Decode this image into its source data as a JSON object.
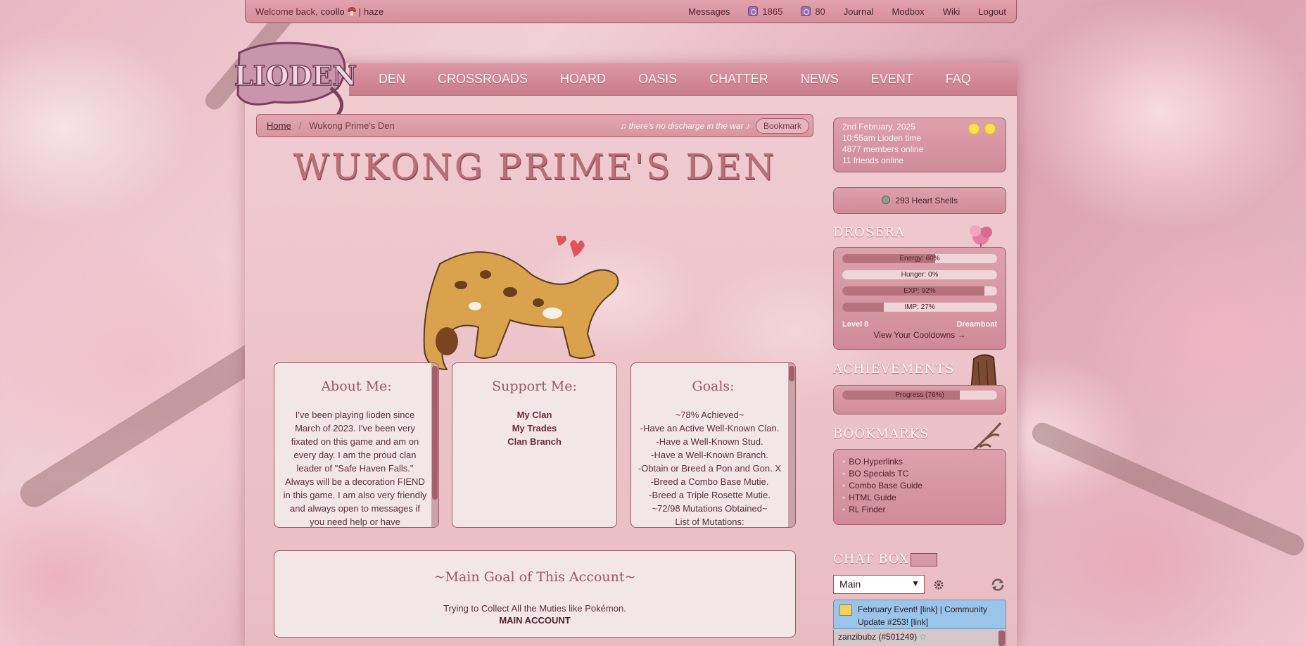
{
  "topbar": {
    "welcome": "Welcome back,",
    "username": "coollo",
    "separator": "|",
    "secondary_user": "haze",
    "messages": "Messages",
    "currency1": "1865",
    "currency2": "80",
    "journal": "Journal",
    "modbox": "Modbox",
    "wiki": "Wiki",
    "logout": "Logout"
  },
  "nav": [
    "DEN",
    "CROSSROADS",
    "HOARD",
    "OASIS",
    "CHATTER",
    "NEWS",
    "EVENT",
    "FAQ"
  ],
  "logo_text": "LIODEN",
  "breadcrumb": {
    "home": "Home",
    "sep": "/",
    "current": "Wukong Prime's Den",
    "song": "♫ there's no discharge in the war ♪",
    "bookmark": "Bookmark"
  },
  "den_title": "WUKONG PRIME'S DEN",
  "about": {
    "title": "About Me:",
    "body": "I've been playing lioden since March of 2023. I've been very fixated on this game and am on every day. I am the proud clan leader of \"Safe Haven Falls.\" Always will be a decoration FIEND in this game. I am also very friendly and always open to messages if you need help or have"
  },
  "support": {
    "title": "Support Me:",
    "links": [
      "My Clan",
      "My Trades",
      "Clan Branch"
    ]
  },
  "goals": {
    "title": "Goals:",
    "lines": [
      "~78% Achieved~",
      "-Have an Active Well-Known Clan.",
      "-Have a Well-Known Stud.",
      "-Have a Well-Known Branch.",
      "-Obtain or Breed a Pon and Gon. X",
      "-Breed a Combo Base Mutie.",
      "-Breed a Triple Rosette Mutie.",
      "~72/98 Mutations Obtained~",
      "List of Mutations:"
    ]
  },
  "main_goal": {
    "title": "~Main Goal of This Account~",
    "text": "Trying to Collect All the Muties like Pokémon.",
    "account": "MAIN ACCOUNT"
  },
  "sidebar": {
    "date": "2nd February, 2025",
    "time": "10:55am Lioden time",
    "members": "4877 members online",
    "friends": "11 friends online",
    "heart_shells": "293 Heart Shells",
    "lion_name": "DROSERA",
    "bars": [
      {
        "label": "Energy: 60%",
        "value": 60
      },
      {
        "label": "Hunger: 0%",
        "value": 0
      },
      {
        "label": "EXP: 92%",
        "value": 92
      },
      {
        "label": "IMP: 27%",
        "value": 27
      }
    ],
    "level": "Level 8",
    "rank": "Dreamboat",
    "cooldowns": "View Your Cooldowns →",
    "achievements_title": "ACHIEVEMENTS",
    "achievements": {
      "label": "Progress (76%)",
      "value": 76
    },
    "bookmarks_title": "BOOKMARKS",
    "bookmarks": [
      "BO Hyperlinks",
      "BO Specials TC",
      "Combo Base Guide",
      "HTML Guide",
      "RL Finder"
    ],
    "chat_title": "CHAT BOX",
    "chat_channel": "Main",
    "chat_news": "February Event! [link] | Community Update #253! [link]",
    "chat_user": "zanzibubz (#501249)"
  },
  "colors": {
    "accent": "#d48e9b",
    "panel": "#f2e6e6",
    "title": "#b86f75"
  }
}
